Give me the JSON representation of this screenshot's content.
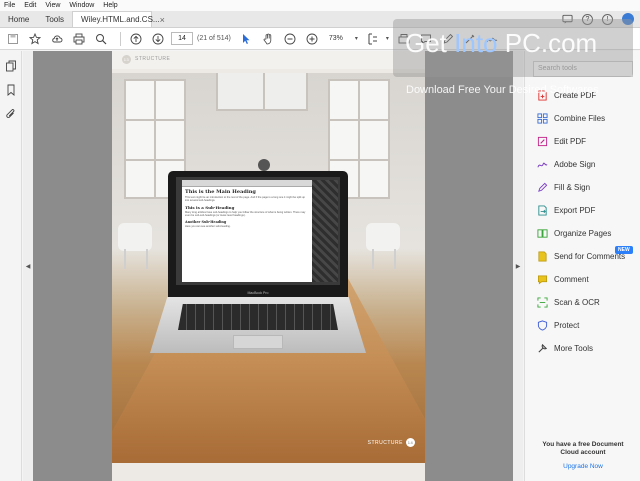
{
  "menu": [
    "File",
    "Edit",
    "View",
    "Window",
    "Help"
  ],
  "tabs": {
    "home": "Home",
    "tools": "Tools",
    "document": "Wiley.HTML.and.CS...",
    "close": "×"
  },
  "toolbar": {
    "page_current": "14",
    "page_count": "(21 of 514)",
    "zoom": "73%",
    "zoom_caret": "▾",
    "fit_caret": "▾"
  },
  "document": {
    "header_section": "STRUCTURE",
    "header_page": "13",
    "footer_section": "STRUCTURE",
    "footer_page": "14",
    "screen": {
      "h1": "This is the Main Heading",
      "p1": "This text might be an introduction to the rest of the page. And if the page is a long one it might be split up into several sub-headings.",
      "h2": "This is a Sub-Heading",
      "p2": "Many long articles have sub-headings to help you follow the structure of what is being written. There may even be sub-sub-headings (or lower-level headings).",
      "h3": "Another Sub-Heading",
      "p3": "Here you can see another sub-heading.",
      "laptop_label": "MacBook Pro"
    }
  },
  "tools_pane": {
    "search_placeholder": "Search tools",
    "items": [
      {
        "label": "Create PDF",
        "icon": "create-pdf-icon",
        "color": "#e0302e"
      },
      {
        "label": "Combine Files",
        "icon": "combine-files-icon",
        "color": "#3b6fd6"
      },
      {
        "label": "Edit PDF",
        "icon": "edit-pdf-icon",
        "color": "#c2248a"
      },
      {
        "label": "Adobe Sign",
        "icon": "adobe-sign-icon",
        "color": "#7b3fc4"
      },
      {
        "label": "Fill & Sign",
        "icon": "fill-sign-icon",
        "color": "#7b3fc4"
      },
      {
        "label": "Export PDF",
        "icon": "export-pdf-icon",
        "color": "#2d8e8e"
      },
      {
        "label": "Organize Pages",
        "icon": "organize-pages-icon",
        "color": "#3aa53a"
      },
      {
        "label": "Send for Comments",
        "icon": "send-for-comments-icon",
        "color": "#e8c21d"
      },
      {
        "label": "Comment",
        "icon": "comment-icon",
        "color": "#e8c21d"
      },
      {
        "label": "Scan & OCR",
        "icon": "scan-ocr-icon",
        "color": "#3aa53a"
      },
      {
        "label": "Protect",
        "icon": "protect-icon",
        "color": "#3b5bd6"
      },
      {
        "label": "More Tools",
        "icon": "more-tools-icon",
        "color": "#444444"
      }
    ],
    "new_badge": "NEW",
    "promo_text": "You have a free Document Cloud account",
    "upgrade_link": "Upgrade Now"
  },
  "watermark": {
    "title_a": "Get ",
    "title_b": "Into",
    "title_c": " PC.",
    "title_d": "com",
    "subtitle": "Download Free Your Desired Softwares"
  }
}
